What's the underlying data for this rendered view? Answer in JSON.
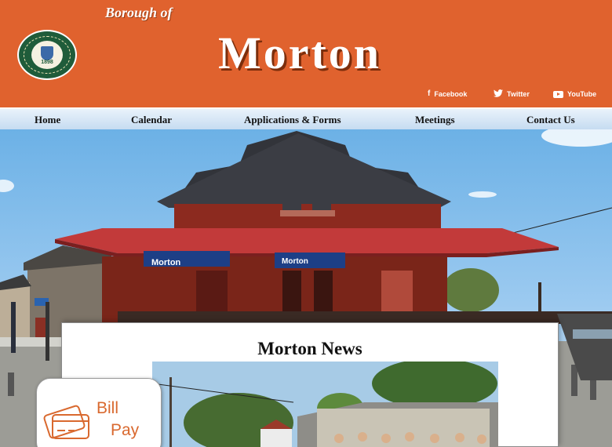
{
  "header": {
    "subtitle": "Borough of",
    "title": "Morton",
    "seal": {
      "text": "THE BOROUGH of MORTON · DELAWARE COUNTY · PENNSYLVANIA",
      "year": "1898"
    },
    "social": [
      {
        "label": "Facebook",
        "icon": "facebook-icon"
      },
      {
        "label": "Twitter",
        "icon": "twitter-icon"
      },
      {
        "label": "YouTube",
        "icon": "youtube-icon"
      }
    ]
  },
  "nav": {
    "items": [
      {
        "label": "Home"
      },
      {
        "label": "Calendar"
      },
      {
        "label": "Applications & Forms"
      },
      {
        "label": "Meetings"
      },
      {
        "label": "Contact Us"
      }
    ]
  },
  "hero": {
    "signs": [
      "Morton",
      "Morton"
    ]
  },
  "news": {
    "title": "Morton News"
  },
  "billpay": {
    "line1": "Bill",
    "line2": "Pay"
  },
  "colors": {
    "header_bg": "#e0622e",
    "nav_bg": "#c6dcf1",
    "billpay_accent": "#d9692f",
    "station_brick": "#8c2a1f",
    "station_roof": "#c23a3a"
  }
}
